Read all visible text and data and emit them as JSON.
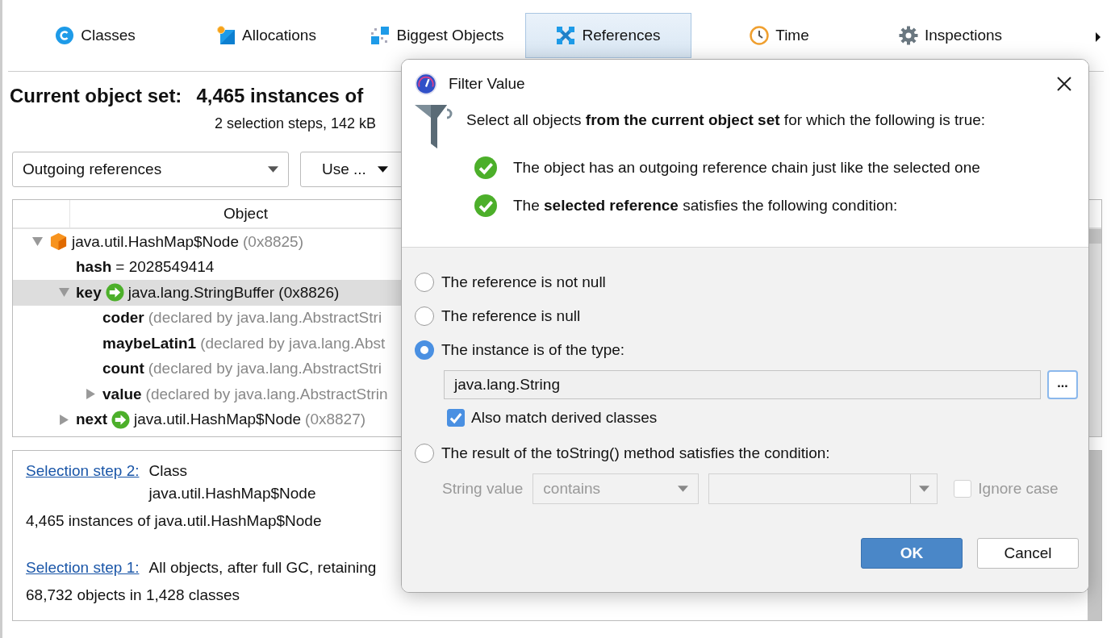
{
  "tabs": [
    {
      "label": "Classes",
      "selected": false
    },
    {
      "label": "Allocations",
      "selected": false
    },
    {
      "label": "Biggest Objects",
      "selected": false
    },
    {
      "label": "References",
      "selected": true
    },
    {
      "label": "Time",
      "selected": false
    },
    {
      "label": "Inspections",
      "selected": false
    }
  ],
  "header": {
    "title": "Current object set:",
    "value": "4,465 instances of",
    "subtitle": "2 selection steps, 142 kB"
  },
  "toolbar": {
    "view_select": "Outgoing references",
    "use_button": "Use ..."
  },
  "tree": {
    "columns": [
      "Object"
    ],
    "nodes": [
      {
        "label": "java.util.HashMap$Node",
        "note": "(0x8825)",
        "kind": "object",
        "expanded": true,
        "selected": false,
        "children": [
          {
            "field": "hash",
            "label": "= 2028549414",
            "selected": false
          },
          {
            "field": "key",
            "label": "java.lang.StringBuffer (0x8826)",
            "kind": "reference",
            "expanded": true,
            "selected": true,
            "children": [
              {
                "field": "coder",
                "note": "(declared by java.lang.AbstractStri",
                "selected": false
              },
              {
                "field": "maybeLatin1",
                "note": "(declared by java.lang.Abst",
                "selected": false
              },
              {
                "field": "count",
                "note": "(declared by java.lang.AbstractStri",
                "selected": false
              },
              {
                "field": "value",
                "note": "(declared by java.lang.AbstractStrin",
                "expanded": false,
                "selected": false
              }
            ]
          },
          {
            "field": "next",
            "label": "java.util.HashMap$Node",
            "note": "(0x8827)",
            "kind": "reference",
            "expanded": false,
            "selected": false
          }
        ]
      }
    ]
  },
  "steps": [
    {
      "link": "Selection step 2:",
      "lines": [
        "Class",
        "java.util.HashMap$Node"
      ],
      "summary": "4,465 instances of java.util.HashMap$Node"
    },
    {
      "link": "Selection step 1:",
      "lines": [
        "All objects, after full GC, retaining"
      ],
      "summary": "68,732 objects in 1,428 classes"
    }
  ],
  "dialog": {
    "title": "Filter Value",
    "intro": "Select all objects **from the current object set** for which the following is true:",
    "checks": [
      "The object has an outgoing reference chain just like the selected one",
      "The **selected reference** satisfies the following condition:"
    ],
    "options": [
      {
        "label": "The reference is not null",
        "selected": false
      },
      {
        "label": "The reference is null",
        "selected": false
      },
      {
        "label": "The instance is of the type:",
        "selected": true,
        "type_value": "java.lang.String",
        "browse": "...",
        "derived": {
          "label": "Also match derived classes",
          "checked": true
        }
      },
      {
        "label": "The result of the toString() method satisfies the condition:",
        "selected": false,
        "condition": {
          "disabled": true,
          "label": "String value",
          "operator": "contains",
          "ignore_case": {
            "label": "Ignore case",
            "checked": false
          }
        }
      }
    ],
    "buttons": [
      {
        "label": "OK",
        "default": true
      },
      {
        "label": "Cancel",
        "default": false
      }
    ]
  }
}
